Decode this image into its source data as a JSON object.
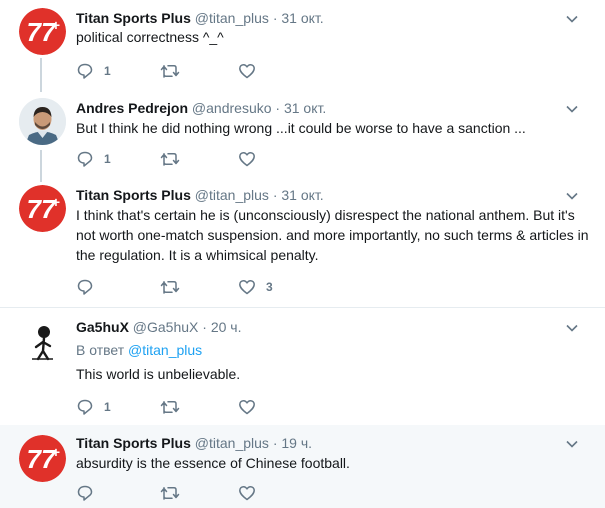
{
  "colors": {
    "brand": "#e0312a",
    "link": "#1da1f2",
    "muted": "#657786",
    "thread_line": "#ccd6dd",
    "highlight_bg": "#f5f8fa"
  },
  "tweets": [
    {
      "name": "Titan Sports Plus",
      "handle": "@titan_plus",
      "separator": "·",
      "time": "31 окт.",
      "avatar": "titan-logo",
      "text": "political correctness ^_^",
      "reply_count": "1",
      "retweet_count": "",
      "like_count": ""
    },
    {
      "name": "Andres Pedrejon",
      "handle": "@andresuko",
      "separator": "·",
      "time": "31 окт.",
      "avatar": "user-photo",
      "text": "But I think he did nothing wrong ...it could be worse to have a sanction ...",
      "reply_count": "1",
      "retweet_count": "",
      "like_count": ""
    },
    {
      "name": "Titan Sports Plus",
      "handle": "@titan_plus",
      "separator": "·",
      "time": "31 окт.",
      "avatar": "titan-logo",
      "text": "I think that's certain he is (unconsciously) disrespect the national anthem. But it's not worth one-match suspension. and more importantly, no such terms & articles in the regulation. It is a whimsical penalty.",
      "reply_count": "",
      "retweet_count": "",
      "like_count": "3"
    },
    {
      "name": "Ga5huX",
      "handle": "@Ga5huX",
      "separator": "·",
      "time": "20 ч.",
      "avatar": "user-sketch",
      "reply_prefix": "В ответ",
      "reply_mention": "@titan_plus",
      "text": "This world is unbelievable.",
      "reply_count": "1",
      "retweet_count": "",
      "like_count": ""
    },
    {
      "name": "Titan Sports Plus",
      "handle": "@titan_plus",
      "separator": "·",
      "time": "19 ч.",
      "avatar": "titan-logo",
      "text": "absurdity is the essence of Chinese football.",
      "reply_count": "",
      "retweet_count": "",
      "like_count": ""
    }
  ]
}
